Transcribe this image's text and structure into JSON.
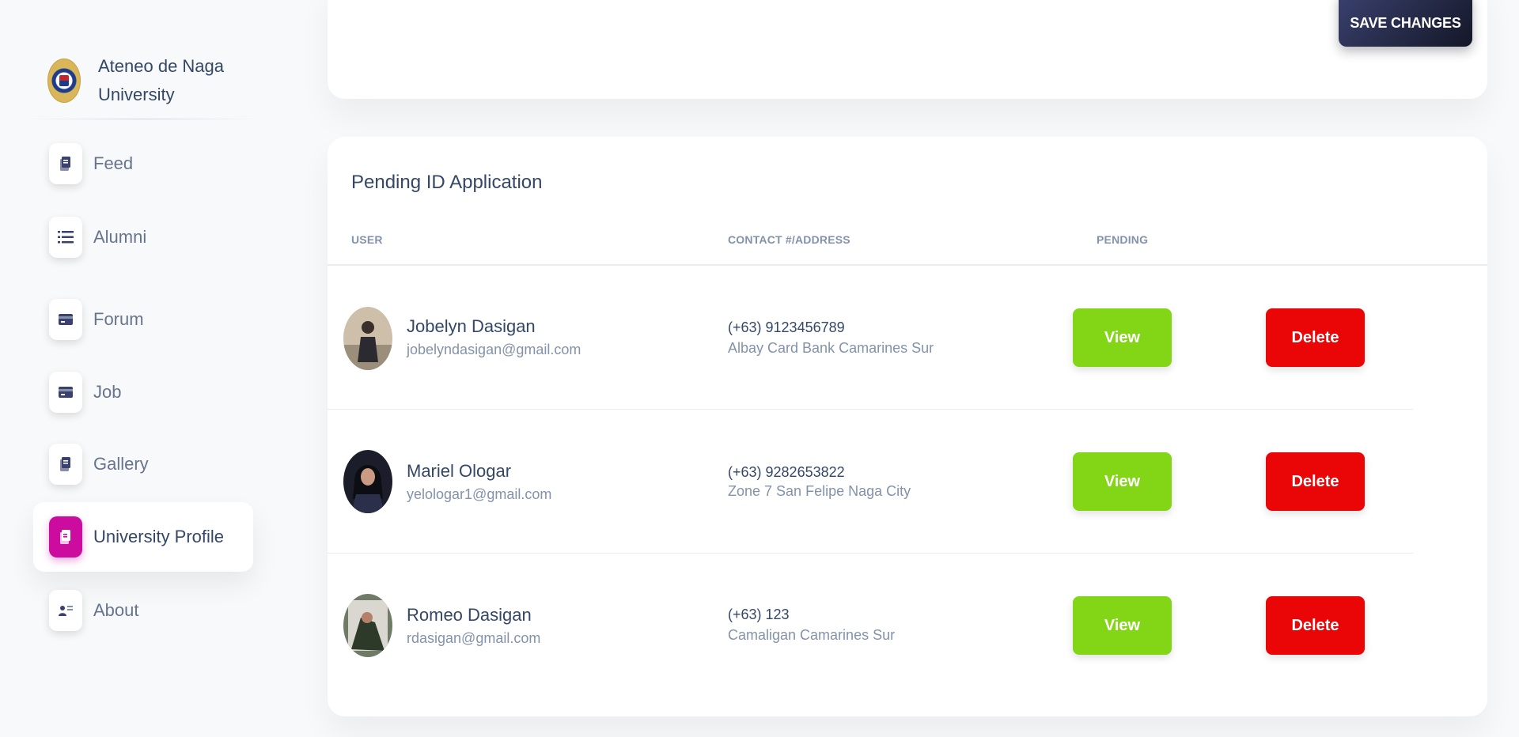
{
  "brand": {
    "name": "Ateneo de Naga University"
  },
  "nav": {
    "items": [
      {
        "label": "Feed",
        "icon": "document-icon",
        "active": false
      },
      {
        "label": "Alumni",
        "icon": "list-icon",
        "active": false
      },
      {
        "label": "Forum",
        "icon": "card-icon",
        "active": false
      },
      {
        "label": "Job",
        "icon": "card-icon",
        "active": false
      },
      {
        "label": "Gallery",
        "icon": "document-icon",
        "active": false
      },
      {
        "label": "University Profile",
        "icon": "document-icon",
        "active": true
      },
      {
        "label": "About",
        "icon": "user-icon",
        "active": false
      }
    ]
  },
  "top_card": {
    "save_label": "SAVE CHANGES"
  },
  "pending": {
    "title": "Pending ID Application",
    "columns": {
      "user": "USER",
      "contact": "CONTACT #/ADDRESS",
      "pending": "PENDING"
    },
    "rows": [
      {
        "name": "Jobelyn Dasigan",
        "email": "jobelyndasigan@gmail.com",
        "phone": "(+63) 9123456789",
        "address": "Albay Card Bank Camarines Sur",
        "view_label": "View",
        "delete_label": "Delete"
      },
      {
        "name": "Mariel Ologar",
        "email": "yelologar1@gmail.com",
        "phone": "(+63) 9282653822",
        "address": "Zone 7 San Felipe Naga City",
        "view_label": "View",
        "delete_label": "Delete"
      },
      {
        "name": "Romeo Dasigan",
        "email": "rdasigan@gmail.com",
        "phone": "(+63) 123",
        "address": "Camaligan Camarines Sur",
        "view_label": "View",
        "delete_label": "Delete"
      }
    ]
  },
  "colors": {
    "accent_active": "#cb0c9f",
    "view_button": "#82d616",
    "delete_button": "#ea0606",
    "save_button": "#252f40"
  }
}
